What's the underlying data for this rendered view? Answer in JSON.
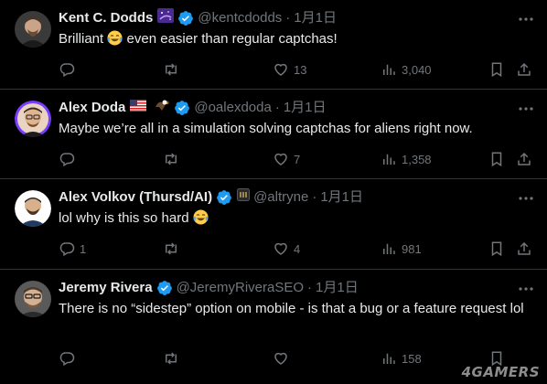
{
  "tweets": [
    {
      "name": "Kent C. Dodds",
      "handle": "@kentcdodds",
      "time": "1月1日",
      "text_before": "Brilliant",
      "text_after": " even easier than regular captchas!",
      "replies": "",
      "retweets": "",
      "likes": "13",
      "views": "3,040"
    },
    {
      "name": "Alex Doda",
      "handle": "@oalexdoda",
      "time": "1月1日",
      "text": "Maybe we’re all in a simulation solving captchas for aliens right now.",
      "replies": "",
      "retweets": "",
      "likes": "7",
      "views": "1,358"
    },
    {
      "name": "Alex Volkov (Thursd/AI)",
      "handle": "@altryne",
      "time": "1月1日",
      "text_before": "lol why is this so hard",
      "replies": "1",
      "retweets": "",
      "likes": "4",
      "views": "981"
    },
    {
      "name": "Jeremy Rivera",
      "handle": "@JeremyRiveraSEO",
      "time": "1月1日",
      "text": "There is no “sidestep” option on mobile - is that a bug or a feature request lol",
      "replies": "",
      "retweets": "",
      "likes": "",
      "views": "158"
    }
  ],
  "watermark": "4GAMERS",
  "colors": {
    "background": "#000000",
    "text": "#e7e9ea",
    "muted": "#71767b",
    "verified": "#1d9bf0",
    "divider": "#2f3336"
  }
}
